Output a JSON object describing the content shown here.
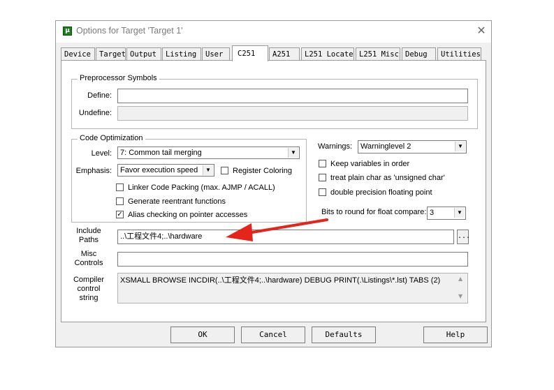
{
  "window": {
    "title": "Options for Target 'Target 1'",
    "icon_text": "µ",
    "close_glyph": "✕"
  },
  "tabs": [
    {
      "label": "Device",
      "active": false
    },
    {
      "label": "Target",
      "active": false
    },
    {
      "label": "Output",
      "active": false
    },
    {
      "label": "Listing",
      "active": false
    },
    {
      "label": "User",
      "active": false
    },
    {
      "label": "C251",
      "active": true
    },
    {
      "label": "A251",
      "active": false
    },
    {
      "label": "L251 Locate",
      "active": false
    },
    {
      "label": "L251 Misc",
      "active": false
    },
    {
      "label": "Debug",
      "active": false
    },
    {
      "label": "Utilities",
      "active": false
    }
  ],
  "preprocessor": {
    "group_label": "Preprocessor Symbols",
    "define_label": "Define:",
    "define_value": "",
    "undefine_label": "Undefine:",
    "undefine_value": ""
  },
  "code_optimization": {
    "group_label": "Code Optimization",
    "level_label": "Level:",
    "level_value": "7: Common tail merging",
    "emphasis_label": "Emphasis:",
    "emphasis_value": "Favor execution speed",
    "register_coloring_label": "Register Coloring",
    "register_coloring_checked": false,
    "linker_packing_label": "Linker Code Packing (max. AJMP / ACALL)",
    "linker_packing_checked": false,
    "reentrant_label": "Generate reentrant functions",
    "reentrant_checked": false,
    "alias_label": "Alias checking on pointer accesses",
    "alias_checked": true
  },
  "warnings": {
    "label": "Warnings:",
    "value": "Warninglevel 2",
    "keep_vars_label": "Keep variables in order",
    "keep_vars_checked": false,
    "plain_char_label": "treat plain char as 'unsigned char'",
    "plain_char_checked": false,
    "double_precision_label": "double precision floating point",
    "double_precision_checked": false,
    "round_bits_label": "Bits to round for float compare:",
    "round_bits_value": "3"
  },
  "include_paths": {
    "label_line1": "Include",
    "label_line2": "Paths",
    "value": "..\\工程文件4;..\\hardware",
    "browse_label": "..."
  },
  "misc_controls": {
    "label_line1": "Misc",
    "label_line2": "Controls",
    "value": ""
  },
  "compiler_control": {
    "label_line1": "Compiler",
    "label_line2": "control",
    "label_line3": "string",
    "value": "XSMALL BROWSE INCDIR(..\\工程文件4;..\\hardware) DEBUG PRINT(.\\Listings\\*.lst) TABS (2)"
  },
  "buttons": {
    "ok": "OK",
    "cancel": "Cancel",
    "defaults": "Defaults",
    "help": "Help"
  },
  "annotation": {
    "arrow_color": "#e5241c"
  },
  "colors": {
    "check_mark": "✓",
    "dropdown_arrow": "▼"
  }
}
